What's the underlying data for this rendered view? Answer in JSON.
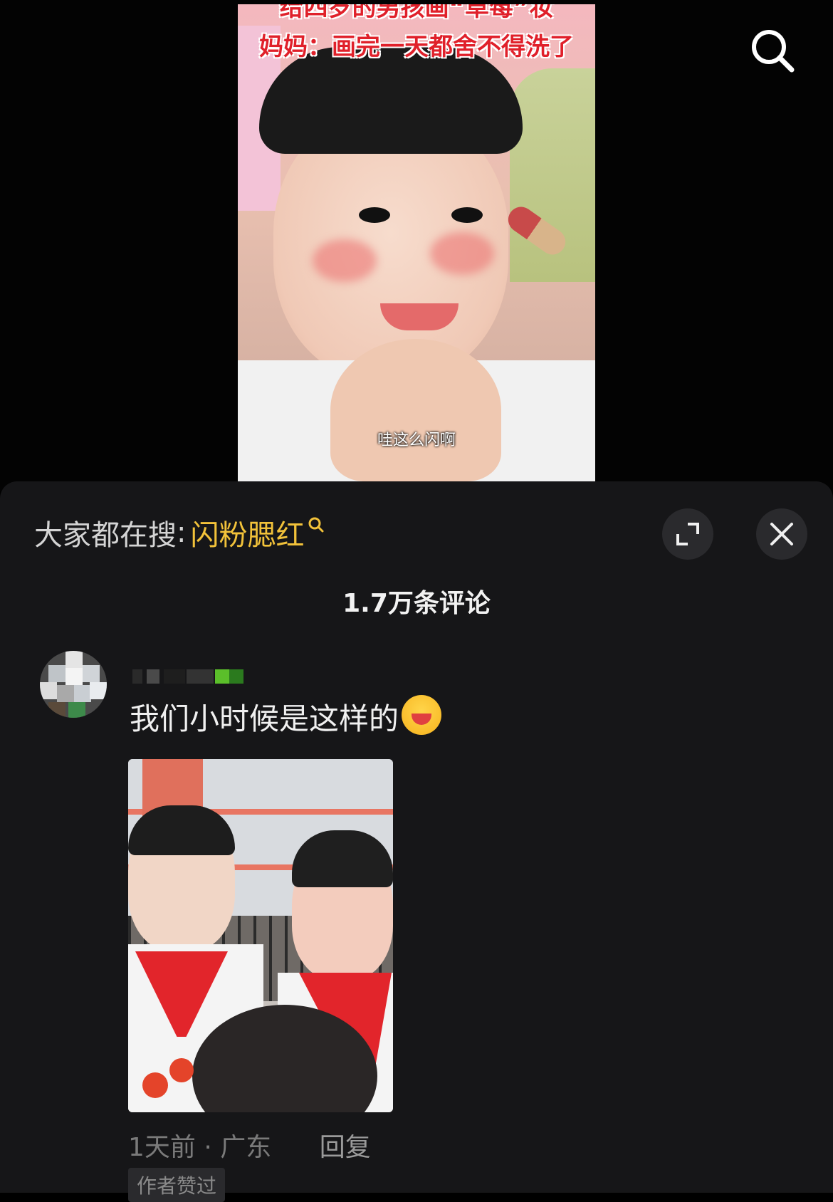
{
  "video": {
    "title_line1": "给四岁的男孩画“草莓”妆",
    "title_line2": "妈妈：画完一天都舍不得洗了",
    "subtitle": "哇这么闪啊"
  },
  "panel": {
    "trending_label": "大家都在搜",
    "trending_sep": ":",
    "trending_term": "闪粉腮红",
    "comment_count": "1.7万条评论"
  },
  "comment": {
    "text": "我们小时候是这样的",
    "time": "1天前",
    "location_sep": " · ",
    "location": "广东",
    "reply_label": "回复",
    "author_liked_label": "作者赞过"
  },
  "icons": {
    "search": "search-icon",
    "expand": "expand-icon",
    "close": "close-icon",
    "emoji": "laughing-tears-emoji-icon"
  },
  "colors": {
    "trending_term": "#f2c23a",
    "panel_bg": "#161618",
    "title_red": "#e0202a"
  }
}
